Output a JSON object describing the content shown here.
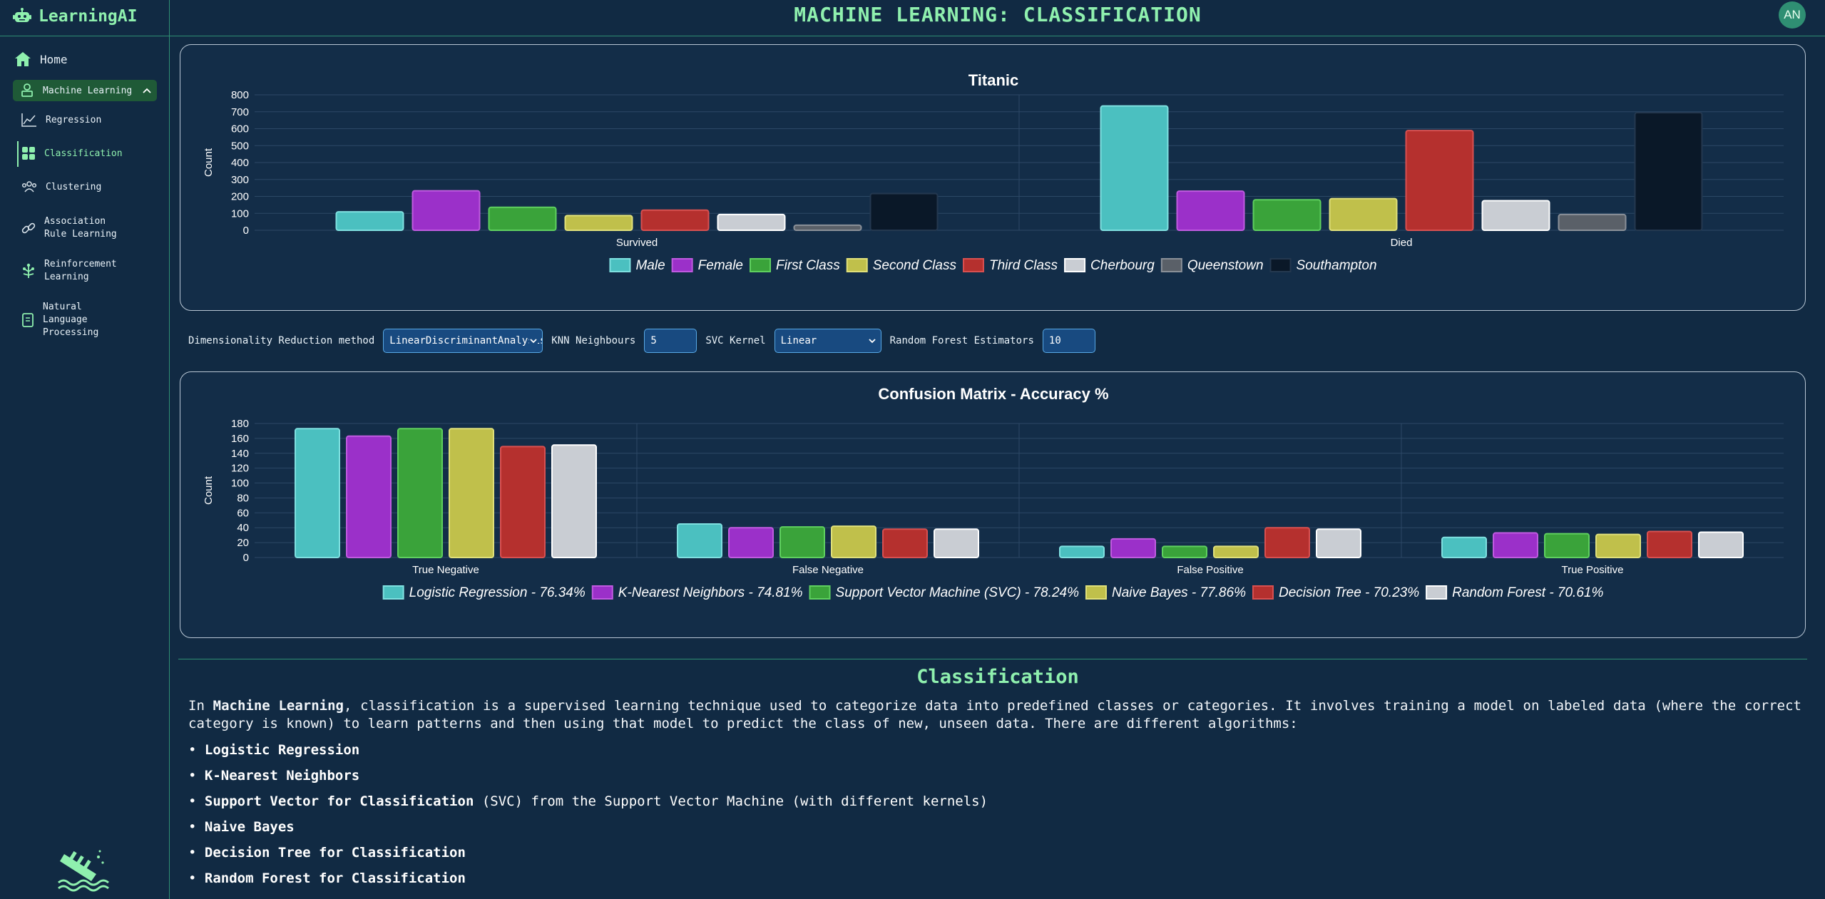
{
  "app": {
    "name": "LearningAI",
    "avatar": "AN"
  },
  "page": {
    "title": "MACHINE LEARNING: CLASSIFICATION"
  },
  "sidebar": {
    "home": "Home",
    "section": "Machine Learning",
    "items": [
      "Regression",
      "Classification",
      "Clustering",
      "Association Rule Learning",
      "Reinforcement Learning",
      "Natural Language Processing"
    ],
    "active": "Classification"
  },
  "controls": {
    "dr_label": "Dimensionality Reduction method",
    "dr_value": "LinearDiscriminantAnalysis",
    "knn_label": "KNN Neighbours",
    "knn_value": "5",
    "svc_label": "SVC Kernel",
    "svc_value": "Linear",
    "rf_label": "Random Forest Estimators",
    "rf_value": "10"
  },
  "content": {
    "title": "Classification",
    "intro_prefix": "In ",
    "intro_bold": "Machine Learning",
    "intro_rest": ", classification is a supervised learning technique used to categorize data into predefined classes or categories. It involves training a model on labeled data (where the correct category is known) to learn patterns and then using that model to predict the class of new, unseen data. There are different algorithms:",
    "algorithms": [
      {
        "bold": "Logistic Regression",
        "rest": ""
      },
      {
        "bold": "K-Nearest Neighbors",
        "rest": ""
      },
      {
        "bold": "Support Vector for Classification",
        "rest": " (SVC) from the Support Vector Machine (with different kernels)"
      },
      {
        "bold": "Naive Bayes",
        "rest": ""
      },
      {
        "bold": "Decision Tree for Classification",
        "rest": ""
      },
      {
        "bold": "Random Forest for Classification",
        "rest": ""
      }
    ]
  },
  "colors": {
    "accent": "#8ff0ae",
    "series": [
      "#4bc0c0",
      "#9b30c9",
      "#3aa33a",
      "#c0c04b",
      "#b5302e",
      "#c9cdd3",
      "#5a6068",
      "#0a1828"
    ],
    "borders": [
      "#7fe0e0",
      "#c05be0",
      "#5fd05f",
      "#e0e07a",
      "#d85050",
      "#ffffff",
      "#8a9098",
      "#24384f"
    ]
  },
  "chart_data": [
    {
      "type": "bar",
      "title": "Titanic",
      "ylabel": "Count",
      "xlabel": "",
      "ylim": [
        0,
        800
      ],
      "yticks": [
        0,
        100,
        200,
        300,
        400,
        500,
        600,
        700,
        800
      ],
      "categories": [
        "Survived",
        "Died"
      ],
      "series": [
        {
          "name": "Male",
          "values": [
            109,
            734
          ]
        },
        {
          "name": "Female",
          "values": [
            233,
            231
          ]
        },
        {
          "name": "First Class",
          "values": [
            136,
            180
          ]
        },
        {
          "name": "Second Class",
          "values": [
            87,
            187
          ]
        },
        {
          "name": "Third Class",
          "values": [
            119,
            589
          ]
        },
        {
          "name": "Cherbourg",
          "values": [
            93,
            175
          ]
        },
        {
          "name": "Queenstown",
          "values": [
            30,
            93
          ]
        },
        {
          "name": "Southampton",
          "values": [
            217,
            695
          ]
        }
      ],
      "legend": "bottom",
      "grid": true
    },
    {
      "type": "bar",
      "title": "Confusion Matrix - Accuracy %",
      "ylabel": "Count",
      "xlabel": "",
      "ylim": [
        0,
        180
      ],
      "yticks": [
        0,
        20,
        40,
        60,
        80,
        100,
        120,
        140,
        160,
        180
      ],
      "categories": [
        "True Negative",
        "False Negative",
        "False Positive",
        "True Positive"
      ],
      "series": [
        {
          "name": "Logistic Regression - 76.34%",
          "values": [
            173,
            45,
            15,
            27
          ]
        },
        {
          "name": "K-Nearest Neighbors - 74.81%",
          "values": [
            163,
            40,
            25,
            33
          ]
        },
        {
          "name": "Support Vector Machine (SVC) - 78.24%",
          "values": [
            173,
            41,
            15,
            32
          ]
        },
        {
          "name": "Naive Bayes - 77.86%",
          "values": [
            173,
            42,
            15,
            31
          ]
        },
        {
          "name": "Decision Tree - 70.23%",
          "values": [
            149,
            38,
            40,
            35
          ]
        },
        {
          "name": "Random Forest - 70.61%",
          "values": [
            151,
            38,
            38,
            34
          ]
        }
      ],
      "legend": "bottom",
      "grid": true
    }
  ]
}
